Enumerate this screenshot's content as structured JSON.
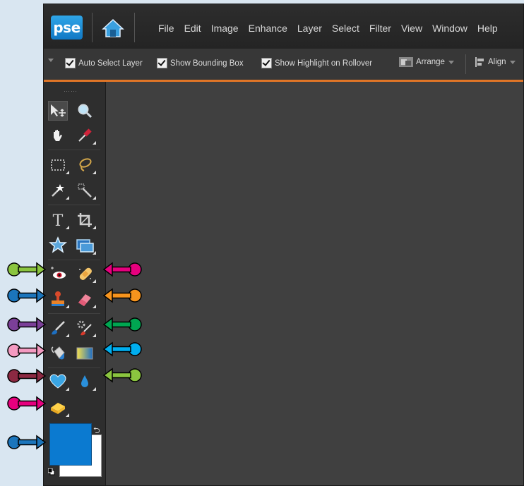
{
  "app": {
    "logo_text": "pse",
    "menus": [
      "File",
      "Edit",
      "Image",
      "Enhance",
      "Layer",
      "Select",
      "Filter",
      "View",
      "Window",
      "Help"
    ]
  },
  "options_bar": {
    "auto_select_layer": {
      "label": "Auto Select Layer",
      "checked": true
    },
    "show_bounding_box": {
      "label": "Show Bounding Box",
      "checked": true
    },
    "show_highlight": {
      "label": "Show Highlight on Rollover",
      "checked": true
    },
    "arrange_label": "Arrange",
    "align_label": "Align"
  },
  "toolbox": {
    "tools": [
      "move-tool",
      "zoom-tool",
      "hand-tool",
      "eyedropper-tool",
      "rectangular-marquee-tool",
      "lasso-tool",
      "magic-wand-tool",
      "quick-selection-tool",
      "type-tool",
      "crop-tool",
      "custom-shape-tool",
      "recompose-tool",
      "red-eye-removal-tool",
      "spot-healing-brush-tool",
      "clone-stamp-tool",
      "eraser-tool",
      "brush-tool",
      "smart-brush-tool",
      "paint-bucket-tool",
      "gradient-tool",
      "shape-tool",
      "blur-tool",
      "sponge-tool"
    ],
    "foreground_color": "#0b7ad0",
    "background_color": "#ffffff"
  },
  "callout_colors": {
    "green": "#8bc53f",
    "magenta": "#e6007e",
    "blue": "#1b75bc",
    "orange": "#f7941d",
    "purple": "#7b3f98",
    "dark_green": "#00a651",
    "pink": "#f49ac1",
    "cyan": "#00aeef",
    "maroon": "#8c2942"
  }
}
